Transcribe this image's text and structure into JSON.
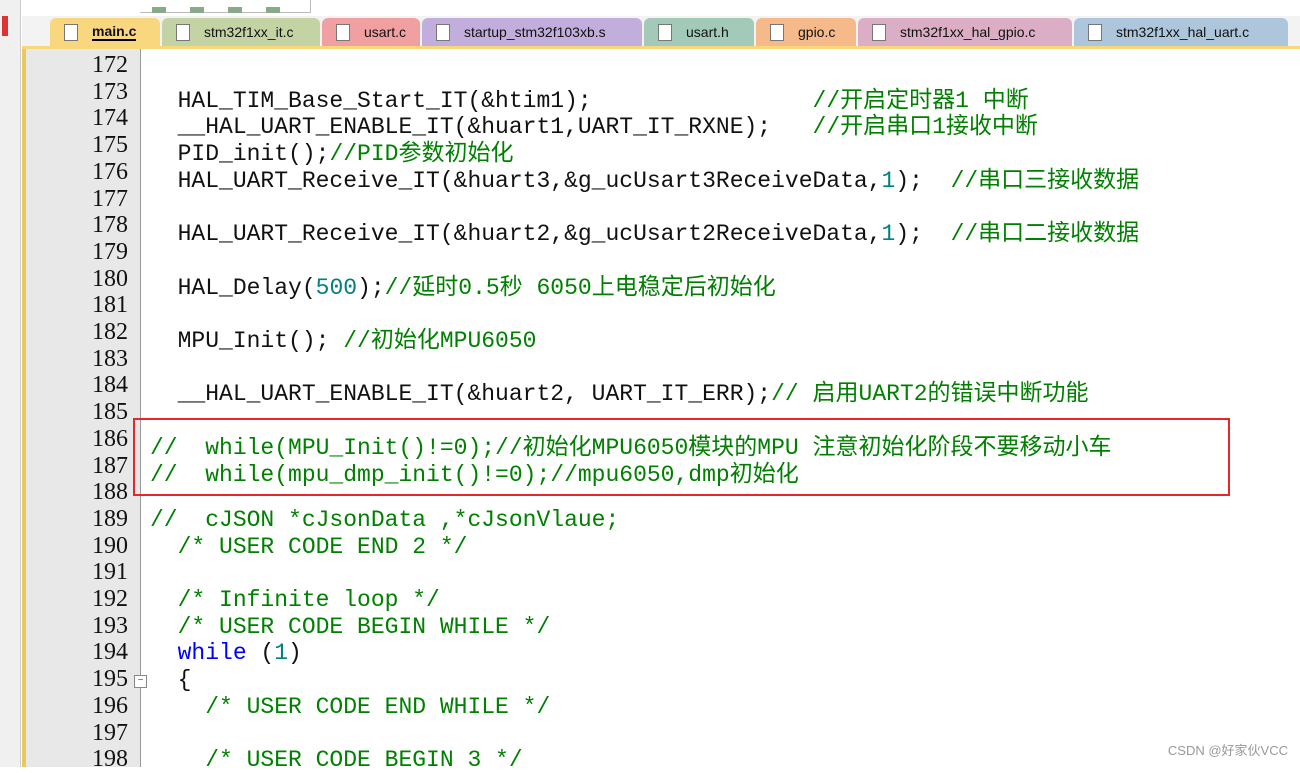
{
  "tabs": [
    {
      "label": "main.c",
      "color": "#f9d77e",
      "active": true
    },
    {
      "label": "stm32f1xx_it.c",
      "color": "#c3d3a4"
    },
    {
      "label": "usart.c",
      "color": "#f0a0a0"
    },
    {
      "label": "startup_stm32f103xb.s",
      "color": "#c2aedc"
    },
    {
      "label": "usart.h",
      "color": "#a3c9b8"
    },
    {
      "label": "gpio.c",
      "color": "#f6b98a"
    },
    {
      "label": "stm32f1xx_hal_gpio.c",
      "color": "#dbaec6"
    },
    {
      "label": "stm32f1xx_hal_uart.c",
      "color": "#adc6dc"
    }
  ],
  "lines": [
    {
      "num": "172",
      "segs": []
    },
    {
      "num": "173",
      "segs": [
        [
          "  HAL_TIM_Base_Start_IT(&htim1);                ",
          "t"
        ],
        [
          "//开启定时器1 中断",
          "c"
        ]
      ]
    },
    {
      "num": "174",
      "segs": [
        [
          "  __HAL_UART_ENABLE_IT(&huart1,UART_IT_RXNE);   ",
          "t"
        ],
        [
          "//开启串口1接收中断",
          "c"
        ]
      ]
    },
    {
      "num": "175",
      "segs": [
        [
          "  PID_init();",
          "t"
        ],
        [
          "//PID参数初始化",
          "c"
        ]
      ]
    },
    {
      "num": "176",
      "segs": [
        [
          "  HAL_UART_Receive_IT(&huart3,&g_ucUsart3ReceiveData,",
          "t"
        ],
        [
          "1",
          "n"
        ],
        [
          ");  ",
          "t"
        ],
        [
          "//串口三接收数据",
          "c"
        ]
      ]
    },
    {
      "num": "177",
      "segs": []
    },
    {
      "num": "178",
      "segs": [
        [
          "  HAL_UART_Receive_IT(&huart2,&g_ucUsart2ReceiveData,",
          "t"
        ],
        [
          "1",
          "n"
        ],
        [
          ");  ",
          "t"
        ],
        [
          "//串口二接收数据",
          "c"
        ]
      ]
    },
    {
      "num": "179",
      "segs": []
    },
    {
      "num": "180",
      "segs": [
        [
          "  HAL_Delay(",
          "t"
        ],
        [
          "500",
          "n"
        ],
        [
          ");",
          "t"
        ],
        [
          "//延时0.5秒 6050上电稳定后初始化",
          "c"
        ]
      ]
    },
    {
      "num": "181",
      "segs": []
    },
    {
      "num": "182",
      "segs": [
        [
          "  MPU_Init(); ",
          "t"
        ],
        [
          "//初始化MPU6050",
          "c"
        ]
      ]
    },
    {
      "num": "183",
      "segs": []
    },
    {
      "num": "184",
      "segs": [
        [
          "  __HAL_UART_ENABLE_IT(&huart2, UART_IT_ERR);",
          "t"
        ],
        [
          "// 启用UART2的错误中断功能",
          "c"
        ]
      ]
    },
    {
      "num": "185",
      "segs": []
    },
    {
      "num": "186",
      "segs": [
        [
          "//  while(MPU_Init()!=0);//初始化MPU6050模块的MPU 注意初始化阶段不要移动小车",
          "c"
        ]
      ]
    },
    {
      "num": "187",
      "segs": [
        [
          "//  while(mpu_dmp_init()!=0);//mpu6050,dmp初始化",
          "c"
        ]
      ]
    },
    {
      "num": "188",
      "segs": []
    },
    {
      "num": "189",
      "segs": [
        [
          "//  cJSON *cJsonData ,*cJsonVlaue;",
          "c"
        ]
      ]
    },
    {
      "num": "190",
      "segs": [
        [
          "  /* USER CODE END 2 */",
          "c"
        ]
      ]
    },
    {
      "num": "191",
      "segs": []
    },
    {
      "num": "192",
      "segs": [
        [
          "  /* Infinite loop */",
          "c"
        ]
      ]
    },
    {
      "num": "193",
      "segs": [
        [
          "  /* USER CODE BEGIN WHILE */",
          "c"
        ]
      ]
    },
    {
      "num": "194",
      "segs": [
        [
          "  ",
          "t"
        ],
        [
          "while",
          "k"
        ],
        [
          " (",
          "t"
        ],
        [
          "1",
          "n"
        ],
        [
          ")",
          "t"
        ]
      ]
    },
    {
      "num": "195",
      "segs": [
        [
          "  {",
          "t"
        ]
      ],
      "fold": "−"
    },
    {
      "num": "196",
      "segs": [
        [
          "    /* USER CODE END WHILE */",
          "c"
        ]
      ]
    },
    {
      "num": "197",
      "segs": []
    },
    {
      "num": "198",
      "segs": [
        [
          "    /* USER CODE BEGIN 3 */",
          "c"
        ]
      ]
    }
  ],
  "watermark": "CSDN @好家伙VCC",
  "highlight_color": "#e5262b"
}
